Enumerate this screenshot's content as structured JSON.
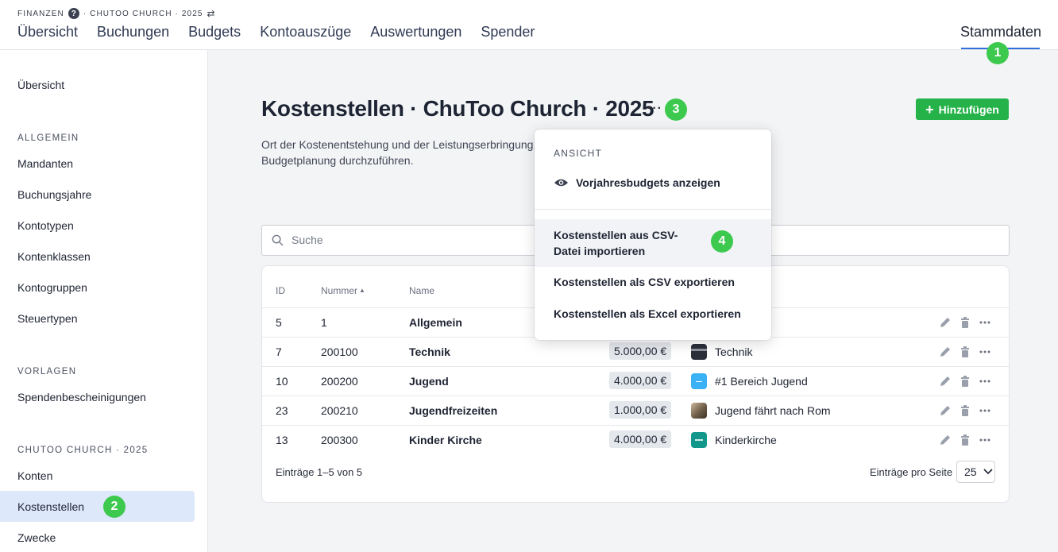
{
  "header": {
    "breadcrumb": {
      "section": "FINANZEN",
      "context": "· CHUTOO CHURCH · 2025"
    },
    "nav": [
      "Übersicht",
      "Buchungen",
      "Budgets",
      "Kontoauszüge",
      "Auswertungen",
      "Spender"
    ],
    "nav_right": "Stammdaten"
  },
  "steps": {
    "one": "1",
    "two": "2",
    "three": "3",
    "four": "4"
  },
  "sidebar": {
    "overview": "Übersicht",
    "section_general": "ALLGEMEIN",
    "general_items": [
      "Mandanten",
      "Buchungsjahre",
      "Kontotypen",
      "Kontenklassen",
      "Kontogruppen",
      "Steuertypen"
    ],
    "section_templates": "VORLAGEN",
    "template_items": [
      "Spendenbescheinigungen"
    ],
    "section_org": "CHUTOO CHURCH · 2025",
    "org_items": [
      "Konten",
      "Kostenstellen",
      "Zwecke"
    ]
  },
  "main": {
    "title": "Kostenstellen · ChuToo Church · 2025",
    "more": "···",
    "description": "Ort der Kostenentstehung und der Leistungserbringung. Budgetplanung durchzuführen.",
    "add_button": "Hinzufügen",
    "search_placeholder": "Suche"
  },
  "table": {
    "columns": {
      "id": "ID",
      "number": "Nummer",
      "name": "Name"
    },
    "rows": [
      {
        "id": "5",
        "number": "1",
        "name": "Allgemein",
        "budget": "",
        "account": ""
      },
      {
        "id": "7",
        "number": "200100",
        "name": "Technik",
        "budget": "5.000,00 €",
        "account": "Technik"
      },
      {
        "id": "10",
        "number": "200200",
        "name": "Jugend",
        "budget": "4.000,00 €",
        "account": "#1 Bereich Jugend"
      },
      {
        "id": "23",
        "number": "200210",
        "name": "Jugendfreizeiten",
        "budget": "1.000,00 €",
        "account": "Jugend fährt nach Rom"
      },
      {
        "id": "13",
        "number": "200300",
        "name": "Kinder Kirche",
        "budget": "4.000,00 €",
        "account": "Kinderkirche"
      }
    ],
    "footer_entries": "Einträge 1–5 von 5",
    "footer_per_page": "Einträge pro Seite",
    "page_size": "25"
  },
  "menu": {
    "section_view": "ANSICHT",
    "show_prev_budgets": "Vorjahresbudgets anzeigen",
    "import_csv": "Kostenstellen aus CSV-Datei importieren",
    "export_csv": "Kostenstellen als CSV exportieren",
    "export_excel": "Kostenstellen als Excel exportieren"
  },
  "colors": {
    "accent": "#2f6fe0",
    "success": "#25b249",
    "step_marker": "#3cc94e",
    "active_bg": "#dde8fb"
  }
}
